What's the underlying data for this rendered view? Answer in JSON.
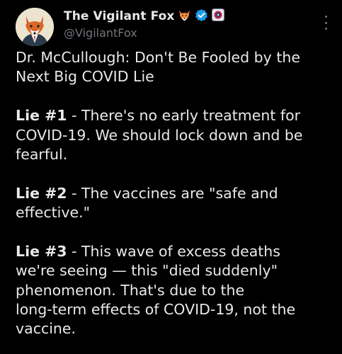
{
  "author": {
    "display_name": "The Vigilant Fox",
    "handle": "@VigilantFox",
    "avatar_icon": "fox-in-suit-avatar",
    "badges": [
      "fox-emoji-icon",
      "verified-badge-icon",
      "affiliate-badge-icon"
    ],
    "verified_color": "#1d9bf0"
  },
  "menu": {
    "icon": "more-options-icon"
  },
  "tweet": {
    "title_lines": [
      "Dr. McCullough: Don't Be Fooled by the",
      "Next Big COVID Lie"
    ],
    "lie1": {
      "label": "Lie #1",
      "line1_rest": " - There's no early treatment for",
      "line2": "COVID-19. We should lock down and be",
      "line3": "fearful."
    },
    "lie2": {
      "label": "Lie #2",
      "line1_rest": " - The vaccines are \"safe and",
      "line2": "effective.\""
    },
    "lie3": {
      "label": "Lie #3",
      "line1_rest": " - This wave of excess deaths",
      "line2": "we're seeing — this \"died suddenly\"",
      "line3": "phenomenon. That's due to the",
      "line4": "long-term effects of COVID-19, not the",
      "line5": "vaccine."
    }
  },
  "colors": {
    "background": "#000000",
    "text": "#e7e9ea",
    "secondary": "#71767b"
  }
}
